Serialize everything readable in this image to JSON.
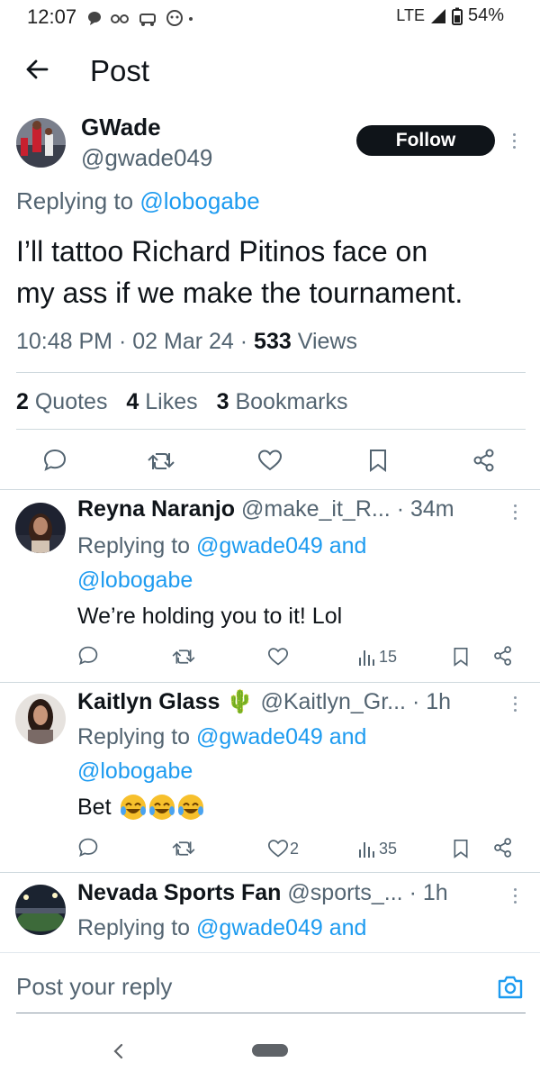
{
  "status_bar": {
    "time": "12:07",
    "network": "LTE",
    "battery": "54%"
  },
  "header": {
    "title": "Post"
  },
  "post": {
    "name": "GWade",
    "handle": "@gwade049",
    "follow_label": "Follow",
    "replying_prefix": "Replying to",
    "replying_to": "@lobogabe",
    "text_line1": "I’ll tattoo Richard Pitinos face on",
    "text_line2": "my ass if we make the tournament.",
    "time": "10:48 PM",
    "sep": "·",
    "date": "02 Mar 24",
    "views_count": "533",
    "views_label": "Views",
    "quotes_count": "2",
    "quotes_label": "Quotes",
    "likes_count": "4",
    "likes_label": "Likes",
    "bookmarks_count": "3",
    "bookmarks_label": "Bookmarks"
  },
  "replies": [
    {
      "name": "Reyna Naranjo",
      "handle": "@make_it_R...",
      "time": "· 34m",
      "replying_prefix": "Replying to",
      "mention1": "@gwade049",
      "and": "and",
      "mention2": "@lobogabe",
      "text": "We’re holding you to it! Lol",
      "likes": "",
      "views": "15"
    },
    {
      "name": "Kaitlyn Glass",
      "emoji": "🌵",
      "handle": "@Kaitlyn_Gr...",
      "time": "· 1h",
      "replying_prefix": "Replying to",
      "mention1": "@gwade049",
      "and": "and",
      "mention2": "@lobogabe",
      "text": "Bet",
      "likes": "2",
      "views": "35"
    },
    {
      "name": "Nevada Sports Fan",
      "handle": "@sports_...",
      "time": "· 1h",
      "replying_prefix": "Replying to",
      "mention1": "@gwade049",
      "and": "and"
    }
  ],
  "composer": {
    "placeholder": "Post your reply"
  },
  "colors": {
    "accent": "#1d9bf0",
    "text": "#0f1419",
    "muted": "#536471"
  }
}
